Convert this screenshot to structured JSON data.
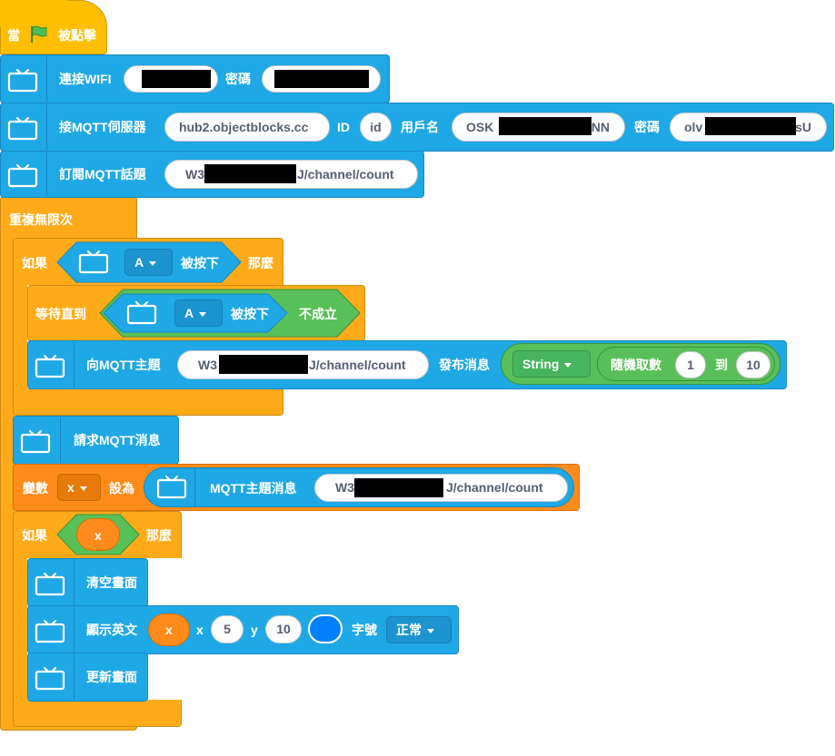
{
  "colors": {
    "control": "#FFAB19",
    "event": "#FFBF00",
    "extension": "#1FA8E6",
    "variable": "#FF8C1A",
    "operator": "#59C059",
    "color_swatch": "#0080FF"
  },
  "hat": {
    "when": "當",
    "clicked": "被點擊",
    "icon": "green-flag-icon"
  },
  "wifi": {
    "label": "連接WIFI",
    "password_label": "密碼"
  },
  "mqtt_connect": {
    "label": "接MQTT伺服器",
    "server": "hub2.objectblocks.cc",
    "id_label": "ID",
    "id_value": "id",
    "user_label": "用戶名",
    "user_value_start": "OSK",
    "user_value_end": "NN",
    "pwd_label": "密碼",
    "pwd_value_start": "olv",
    "pwd_value_end": "sU"
  },
  "subscribe": {
    "label": "訂閱MQTT話題",
    "topic_start": "W3",
    "topic_end": "J/channel/count"
  },
  "forever": {
    "label": "重複無限次"
  },
  "if1": {
    "if_label": "如果",
    "button": "A",
    "pressed": "被按下",
    "then": "那麼"
  },
  "wait": {
    "label": "等待直到",
    "button": "A",
    "pressed": "被按下",
    "not": "不成立"
  },
  "publish": {
    "label": "向MQTT主題",
    "topic_start": "W3",
    "topic_end": "J/channel/count",
    "msg_label": "發布消息",
    "type": "String",
    "random_label": "隨機取數",
    "from": "1",
    "to_label": "到",
    "to": "10"
  },
  "request": {
    "label": "請求MQTT消息"
  },
  "setvar": {
    "label": "變數",
    "var": "x",
    "set_to": "設為",
    "reporter": "MQTT主題消息",
    "topic_start": "W3",
    "topic_end": "J/channel/count"
  },
  "if2": {
    "if_label": "如果",
    "var": "x",
    "then": "那麼"
  },
  "clear": {
    "label": "清空畫面"
  },
  "show": {
    "label": "顯示英文",
    "var": "x",
    "x_label": "x",
    "x_val": "5",
    "y_label": "y",
    "y_val": "10",
    "font_label": "字號",
    "font": "正常"
  },
  "update": {
    "label": "更新畫面"
  },
  "loop_icon": "loop-arrow-icon"
}
